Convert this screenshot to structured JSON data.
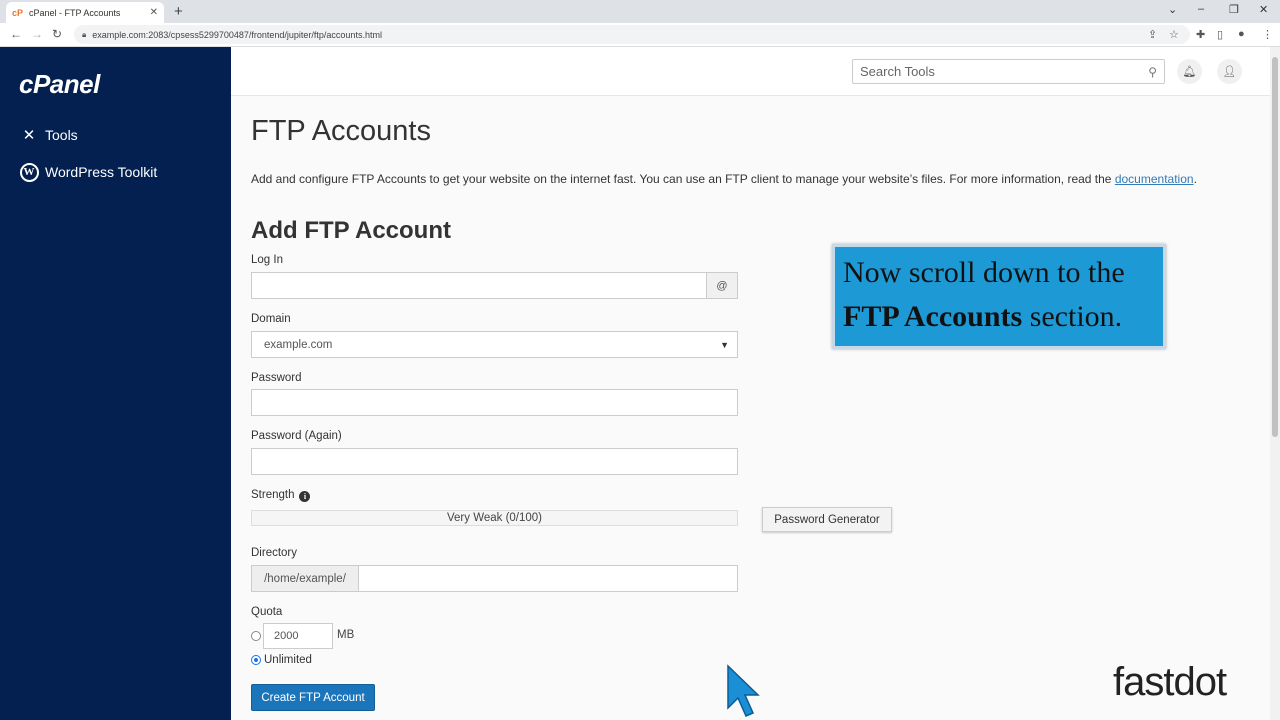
{
  "browser": {
    "tab_title": "cPanel - FTP Accounts",
    "tab_favicon": "cP",
    "url": "example.com:2083/cpsess5299700487/frontend/jupiter/ftp/accounts.html"
  },
  "sidebar": {
    "logo": "cPanel",
    "items": [
      {
        "label": "Tools",
        "icon": "tools-icon"
      },
      {
        "label": "WordPress Toolkit",
        "icon": "wordpress-icon"
      }
    ]
  },
  "header": {
    "search_placeholder": "Search Tools"
  },
  "main": {
    "title": "FTP Accounts",
    "intro_text": "Add and configure FTP Accounts to get your website on the internet fast. You can use an FTP client to manage your website’s files. For more information, read the ",
    "intro_link": "documentation",
    "intro_end": "."
  },
  "form": {
    "section_title": "Add FTP Account",
    "login_label": "Log In",
    "login_addon": "@",
    "domain_label": "Domain",
    "domain_value": "example.com",
    "password_label": "Password",
    "password_again_label": "Password (Again)",
    "strength_label": "Strength",
    "strength_value": "Very Weak (0/100)",
    "password_generator": "Password Generator",
    "directory_label": "Directory",
    "directory_prefix": "/home/example/",
    "quota_label": "Quota",
    "quota_value": "2000",
    "quota_unit": "MB",
    "unlimited_label": "Unlimited",
    "unlimited_selected": true,
    "create_button": "Create FTP Account"
  },
  "overlay": {
    "caption_line1": "Now scroll down to the",
    "caption_bold": "FTP Accounts",
    "caption_end": " section."
  },
  "watermark": {
    "text": "fastdot"
  },
  "colors": {
    "sidebar_bg": "#032050",
    "primary_button": "#1b75bb",
    "caption_bg": "#1d9ad6",
    "watermark_red": "#d81f26"
  }
}
